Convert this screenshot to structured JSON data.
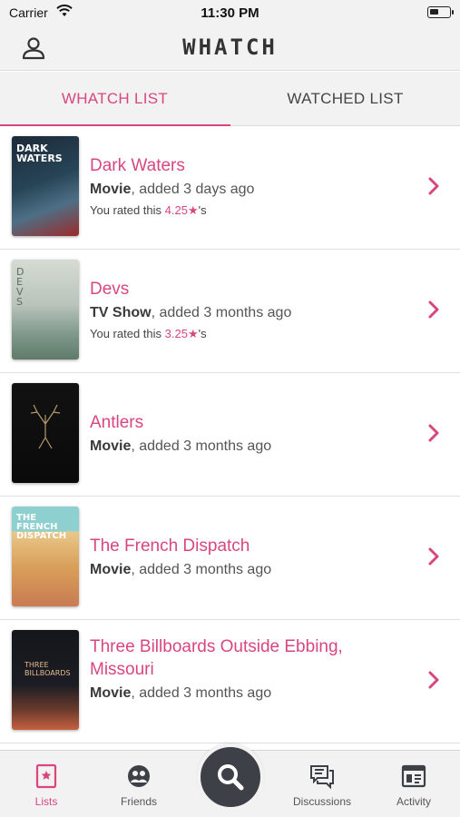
{
  "status_bar": {
    "carrier": "Carrier",
    "time": "11:30 PM"
  },
  "header": {
    "logo": "WHATCH"
  },
  "tabs": [
    {
      "label": "WHATCH LIST",
      "active": true
    },
    {
      "label": "WATCHED LIST",
      "active": false
    }
  ],
  "list": [
    {
      "title": "Dark Waters",
      "type": "Movie",
      "added": ", added 3 days ago",
      "rating_prefix": "You rated this ",
      "rating": "4.25★",
      "rating_suffix": "'s",
      "poster_text": "DARK WATERS",
      "poster_colors": [
        "#1c2a38",
        "#4d6f85"
      ]
    },
    {
      "title": "Devs",
      "type": "TV Show",
      "added": ", added 3 months ago",
      "rating_prefix": "You rated this ",
      "rating": "3.25★",
      "rating_suffix": "'s",
      "poster_text": "DEVS",
      "poster_colors": [
        "#c9cfc7",
        "#6f8a7d"
      ]
    },
    {
      "title": "Antlers",
      "type": "Movie",
      "added": ", added 3 months ago",
      "poster_colors": [
        "#0d0d0d",
        "#1b1815"
      ]
    },
    {
      "title": "The French Dispatch",
      "type": "Movie",
      "added": ", added 3 months ago",
      "poster_text": "THE FRENCH DISPATCH",
      "poster_colors": [
        "#8ed0cf",
        "#e4a35a"
      ]
    },
    {
      "title": "Three Billboards Outside Ebbing, Missouri",
      "type": "Movie",
      "added": ", added 3 months ago",
      "poster_text": "THREE BILLBOARDS",
      "poster_colors": [
        "#1b1d24",
        "#b5523a"
      ]
    }
  ],
  "tabbar": [
    {
      "label": "Lists",
      "icon": "lists-icon",
      "active": true
    },
    {
      "label": "Friends",
      "icon": "friends-icon",
      "active": false
    },
    {
      "label": "Discussions",
      "icon": "discussions-icon",
      "active": false
    },
    {
      "label": "Activity",
      "icon": "activity-icon",
      "active": false
    }
  ],
  "colors": {
    "accent": "#d9467f",
    "dark": "#3d4147",
    "bar_bg": "#f2f2f2"
  }
}
